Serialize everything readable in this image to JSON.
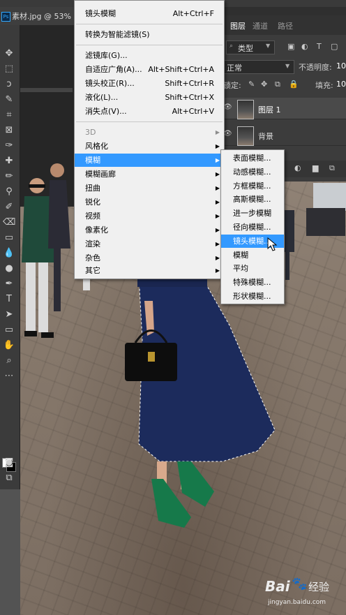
{
  "document": {
    "tab_title": "素材.jpg @ 53% (",
    "app_icon": "Ps"
  },
  "panel": {
    "tabs": [
      "图层",
      "通道",
      "路径"
    ],
    "filter_kind": "类型",
    "blend_mode": "正常",
    "opacity_label": "不透明度:",
    "opacity_value": "10",
    "lock_label": "锁定:",
    "fill_label": "填充:",
    "fill_value": "10",
    "layers": [
      {
        "name": "图层 1"
      },
      {
        "name": "背景"
      }
    ]
  },
  "filter_menu": {
    "items": [
      {
        "label": "镜头模糊",
        "shortcut": "Alt+Ctrl+F"
      },
      {
        "label": "转换为智能滤镜(S)",
        "shortcut": ""
      },
      {
        "label": "滤镜库(G)...",
        "shortcut": ""
      },
      {
        "label": "自适应广角(A)...",
        "shortcut": "Alt+Shift+Ctrl+A"
      },
      {
        "label": "镜头校正(R)...",
        "shortcut": "Shift+Ctrl+R"
      },
      {
        "label": "液化(L)...",
        "shortcut": "Shift+Ctrl+X"
      },
      {
        "label": "消失点(V)...",
        "shortcut": "Alt+Ctrl+V"
      },
      {
        "label": "3D",
        "disabled": true
      },
      {
        "label": "风格化"
      },
      {
        "label": "模糊",
        "selected": true
      },
      {
        "label": "模糊画廊"
      },
      {
        "label": "扭曲"
      },
      {
        "label": "锐化"
      },
      {
        "label": "视频"
      },
      {
        "label": "像素化"
      },
      {
        "label": "渲染"
      },
      {
        "label": "杂色"
      },
      {
        "label": "其它"
      }
    ]
  },
  "blur_submenu": {
    "items": [
      {
        "label": "表面模糊..."
      },
      {
        "label": "动感模糊..."
      },
      {
        "label": "方框模糊..."
      },
      {
        "label": "高斯模糊..."
      },
      {
        "label": "进一步模糊"
      },
      {
        "label": "径向模糊..."
      },
      {
        "label": "镜头模糊...",
        "selected": true
      },
      {
        "label": "模糊"
      },
      {
        "label": "平均"
      },
      {
        "label": "特殊模糊..."
      },
      {
        "label": "形状模糊..."
      }
    ]
  },
  "watermark": {
    "brand": "Bai",
    "brand2": "经验",
    "url": "jingyan.baidu.com"
  },
  "colors": {
    "menu_highlight": "#3399ff",
    "menu_bg": "#f0f0f0",
    "dress": "#1c2b5c",
    "shoes": "#16794a"
  }
}
